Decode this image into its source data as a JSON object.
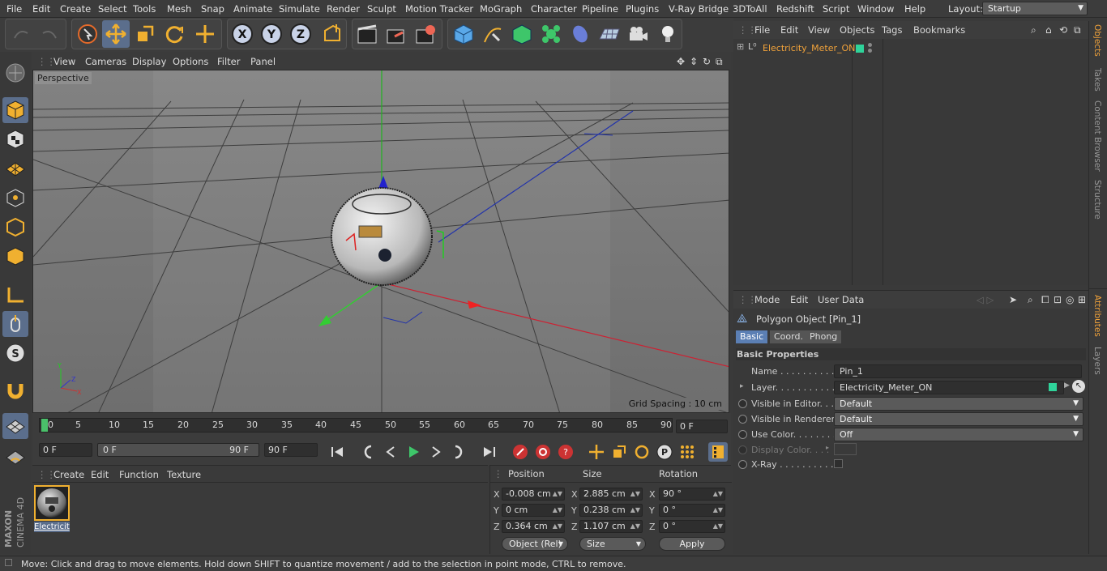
{
  "menubar": {
    "items": [
      "File",
      "Edit",
      "Create",
      "Select",
      "Tools",
      "Mesh",
      "Snap",
      "Animate",
      "Simulate",
      "Render",
      "Sculpt",
      "Motion Tracker",
      "MoGraph",
      "Character",
      "Pipeline",
      "Plugins",
      "V-Ray Bridge",
      "3DToAll",
      "Redshift",
      "Script",
      "Window",
      "Help"
    ],
    "layout_label": "Layout:",
    "layout_value": "Startup"
  },
  "viewport": {
    "menu": [
      "View",
      "Cameras",
      "Display",
      "Options",
      "Filter",
      "Panel"
    ],
    "label": "Perspective",
    "grid_spacing": "Grid Spacing : 10 cm"
  },
  "timeline": {
    "ticks": [
      "0",
      "5",
      "10",
      "15",
      "20",
      "25",
      "30",
      "35",
      "40",
      "45",
      "50",
      "55",
      "60",
      "65",
      "70",
      "75",
      "80",
      "85",
      "90"
    ],
    "current_frame": "0 F"
  },
  "playbar": {
    "start": "0 F",
    "range_start": "0 F",
    "range_end": "90 F",
    "end": "90 F"
  },
  "material": {
    "menu": [
      "Create",
      "Edit",
      "Function",
      "Texture"
    ],
    "item_label": "Electricit"
  },
  "coords": {
    "headers": [
      "Position",
      "Size",
      "Rotation"
    ],
    "axes": [
      "X",
      "Y",
      "Z"
    ],
    "position": [
      "-0.008 cm",
      "0 cm",
      "0.364 cm"
    ],
    "size": [
      "2.885 cm",
      "0.238 cm",
      "1.107 cm"
    ],
    "size_axes": [
      "X",
      "Y",
      "Z"
    ],
    "rotation_axes": [
      "X",
      "Y",
      "Z"
    ],
    "rotation": [
      "90 °",
      "0 °",
      "0 °"
    ],
    "mode_select": "Object (Rel)",
    "size_select": "Size",
    "apply": "Apply"
  },
  "object_manager": {
    "menu": [
      "File",
      "Edit",
      "View",
      "Objects",
      "Tags",
      "Bookmarks"
    ],
    "object_name": "Electricity_Meter_ON",
    "layer_color": "#2fd39a"
  },
  "attributes": {
    "menu": [
      "Mode",
      "Edit",
      "User Data"
    ],
    "title": "Polygon Object [Pin_1]",
    "tabs": [
      "Basic",
      "Coord.",
      "Phong"
    ],
    "section": "Basic Properties",
    "rows": [
      {
        "label": "Name . . . . . . . . . . . .",
        "value": "Pin_1"
      },
      {
        "label": "Layer. . . . . . . . . . . .",
        "value": "Electricity_Meter_ON"
      },
      {
        "label": "Visible in Editor. . .",
        "value": "Default"
      },
      {
        "label": "Visible in Renderer",
        "value": "Default"
      },
      {
        "label": "Use Color. . . . . . . .",
        "value": "Off"
      },
      {
        "label": "Display Color. . . .",
        "value": ""
      },
      {
        "label": "X-Ray . . . . . . . . . . .",
        "value": ""
      }
    ]
  },
  "right_tabs": [
    "Objects",
    "Takes",
    "Content Browser",
    "Structure",
    "Attributes",
    "Layers"
  ],
  "branding": {
    "maxon": "MAXON",
    "cinema": "CINEMA 4D"
  },
  "status": "Move: Click and drag to move elements. Hold down SHIFT to quantize movement / add to the selection in point mode, CTRL to remove.",
  "colors": {
    "accent": "#5b6e8c",
    "active_tab": "#5b7fb4",
    "orange": "#f2a33a"
  }
}
